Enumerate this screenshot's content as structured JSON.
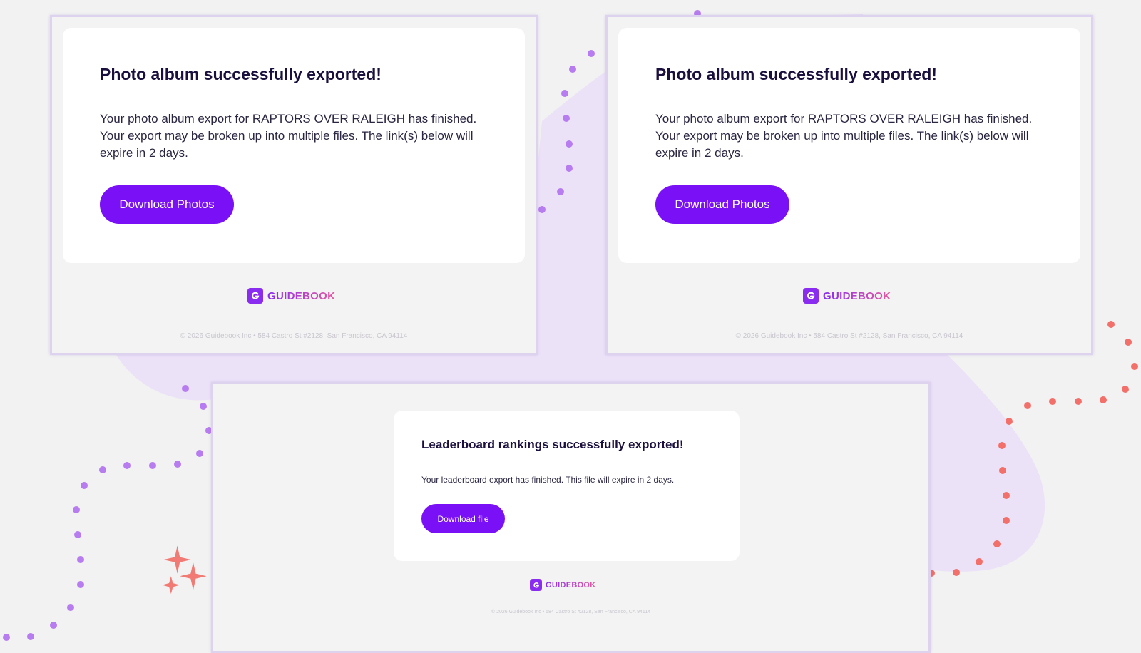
{
  "colors": {
    "background": "#f2f2f2",
    "accent_purple": "#7a10f5",
    "blob_lavender": "#ece2f8",
    "dots_purple": "#b77cf0",
    "dots_coral": "#f26f6a",
    "sparkle": "#f27a74",
    "title_text": "#1a0f3d"
  },
  "emails": {
    "photo_left": {
      "title": "Photo album successfully exported!",
      "body": "Your photo album export for RAPTORS OVER RALEIGH has finished. Your export may be broken up into multiple files. The link(s) below will expire in 2 days.",
      "button_label": "Download Photos",
      "logo_text": "GUIDEBOOK",
      "footer": "© 2026 Guidebook Inc • 584 Castro St #2128, San Francisco, CA 94114"
    },
    "photo_right": {
      "title": "Photo album successfully exported!",
      "body": "Your photo album export for RAPTORS OVER RALEIGH has finished. Your export may be broken up into multiple files. The link(s) below will expire in 2 days.",
      "button_label": "Download Photos",
      "logo_text": "GUIDEBOOK",
      "footer": "© 2026 Guidebook Inc • 584 Castro St #2128, San Francisco, CA 94114"
    },
    "leaderboard": {
      "title": "Leaderboard rankings successfully exported!",
      "body": "Your leaderboard export has finished. This file will expire in 2 days.",
      "button_label": "Download file",
      "logo_text": "GUIDEBOOK",
      "footer": "© 2026 Guidebook Inc • 584 Castro St #2128, San Francisco, CA 94114"
    }
  },
  "icons": {
    "logo": "guidebook-logo-icon",
    "sparkle": "sparkle-icon"
  }
}
